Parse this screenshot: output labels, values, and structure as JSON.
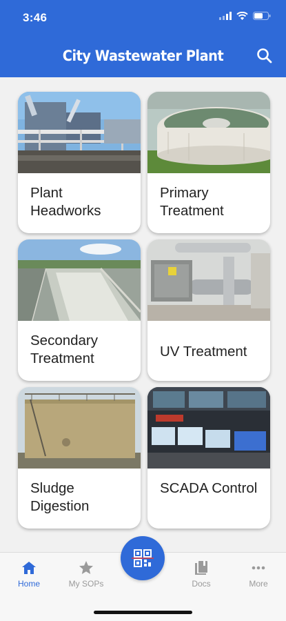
{
  "status_bar": {
    "time": "3:46"
  },
  "header": {
    "title": "City Wastewater Plant",
    "search_icon": "search-icon"
  },
  "cards": [
    {
      "label": "Plant Headworks",
      "image": "headworks-photo"
    },
    {
      "label": "Primary Treatment",
      "image": "clarifier-photo"
    },
    {
      "label": "Secondary Treatment",
      "image": "aeration-basin-photo"
    },
    {
      "label": "UV Treatment",
      "image": "uv-equipment-photo"
    },
    {
      "label": "Sludge Digestion",
      "image": "digester-tank-photo"
    },
    {
      "label": "SCADA Control",
      "image": "control-room-photo"
    }
  ],
  "tabs": [
    {
      "label": "Home",
      "icon": "home-icon",
      "active": true
    },
    {
      "label": "My SOPs",
      "icon": "star-icon",
      "active": false
    },
    {
      "label": "Docs",
      "icon": "docs-icon",
      "active": false
    },
    {
      "label": "More",
      "icon": "more-icon",
      "active": false
    }
  ],
  "fab": {
    "icon": "qr-scan-icon"
  },
  "colors": {
    "primary": "#2f6ad8",
    "inactive": "#9a9a9a",
    "background": "#f1f1f1"
  }
}
